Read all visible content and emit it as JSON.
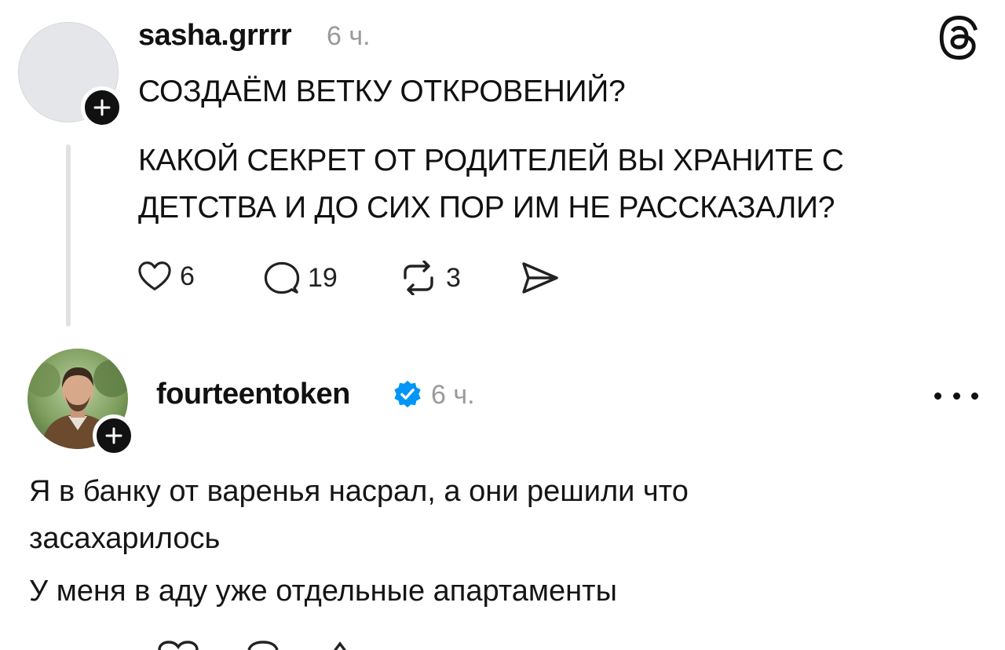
{
  "app": "Threads",
  "post1": {
    "username": "sasha.grrrr",
    "time": "6 ч.",
    "text_line1": "СОЗДАЁМ ВЕТКУ ОТКРОВЕНИЙ?",
    "text_line2": "КАКОЙ СЕКРЕТ ОТ РОДИТЕЛЕЙ ВЫ ХРАНИТЕ С",
    "text_line3": "ДЕТСТВА И ДО СИХ ПОР ИМ НЕ РАССКАЗАЛИ?",
    "likes": "6",
    "replies": "19",
    "reposts": "3"
  },
  "post2": {
    "username": "fourteentoken",
    "verified": true,
    "time": "6 ч.",
    "text_line1": "Я в банку от варенья насрал, а они решили что",
    "text_line2": "засахарилось",
    "text_line3": "У меня в аду уже отдельные апартаменты"
  },
  "icons": {
    "logo": "threads-logo-icon",
    "like": "heart-icon",
    "reply": "comment-icon",
    "repost": "repost-icon",
    "share": "send-icon",
    "follow": "plus-icon",
    "verified": "verified-badge-icon",
    "more": "more-icon"
  },
  "colors": {
    "text": "#111111",
    "muted": "#9a9a9a",
    "verified": "#0095f6",
    "thread_line": "#e1e1e1"
  }
}
